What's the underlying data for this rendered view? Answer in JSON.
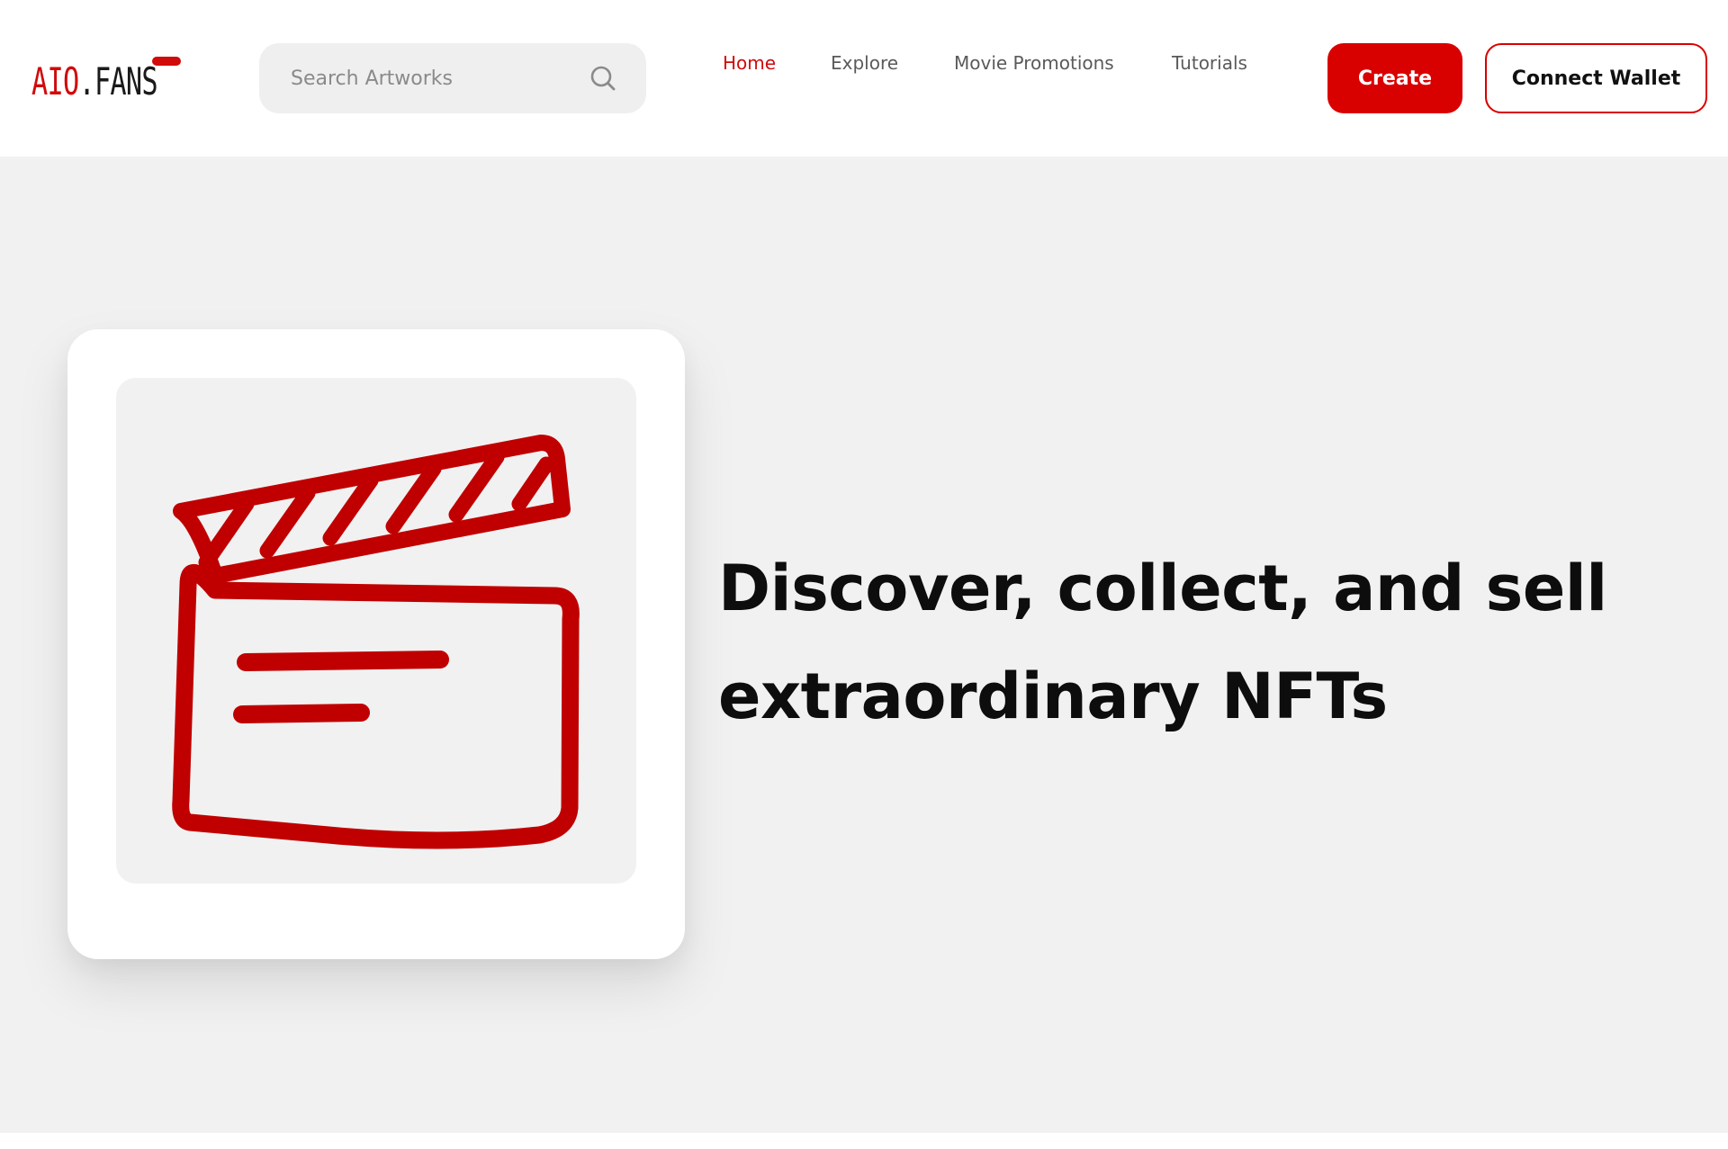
{
  "header": {
    "logo": {
      "part1": "AIO",
      "part2": ".FANS"
    },
    "search": {
      "placeholder": "Search Artworks"
    },
    "nav": [
      {
        "label": "Home",
        "active": true
      },
      {
        "label": "Explore",
        "active": false
      },
      {
        "label": "Movie Promotions",
        "active": false
      },
      {
        "label": "Tutorials",
        "active": false
      }
    ],
    "create_label": "Create",
    "wallet_label": "Connect Wallet"
  },
  "hero": {
    "image_icon": "clapperboard-icon",
    "headline_line1": "Discover, collect, and sell",
    "headline_line2": "extraordinary NFTs"
  },
  "colors": {
    "accent": "#d90000",
    "clapper": "#c00000",
    "hero_bg": "#f1f1f1",
    "text": "#0d0d0d"
  }
}
